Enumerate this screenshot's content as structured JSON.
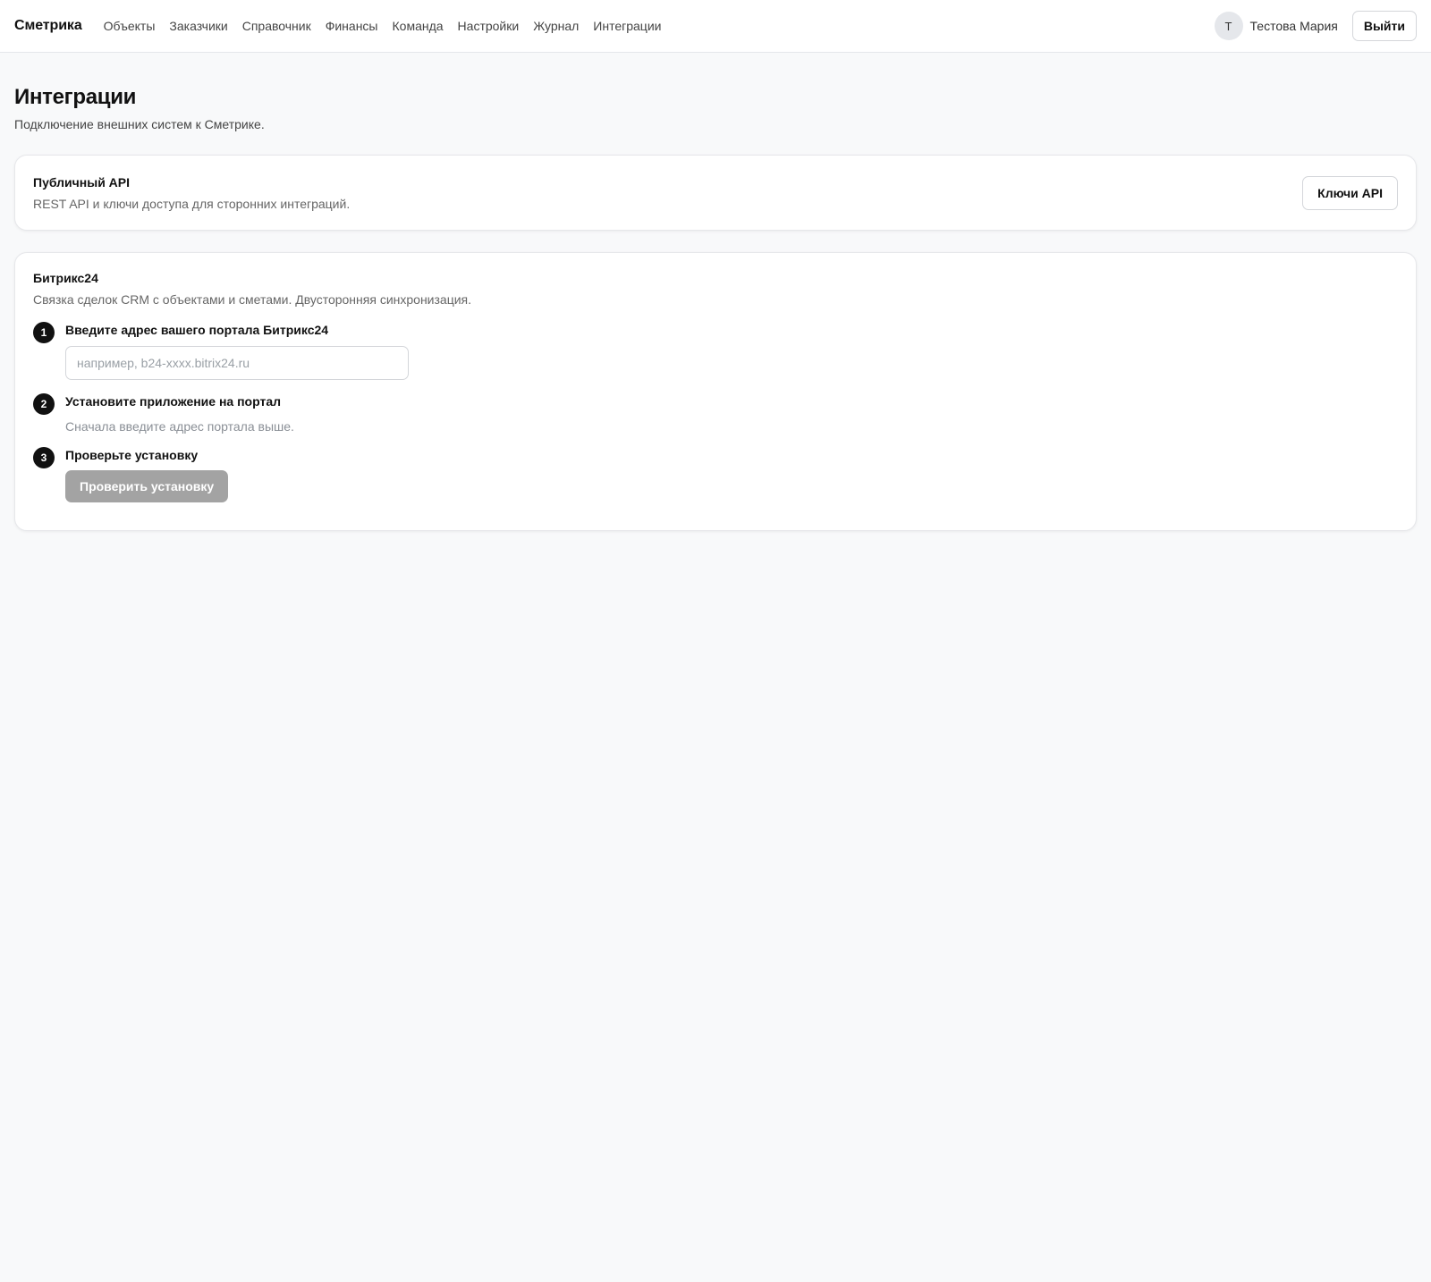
{
  "header": {
    "brand": "Сметрика",
    "nav": [
      "Объекты",
      "Заказчики",
      "Справочник",
      "Финансы",
      "Команда",
      "Настройки",
      "Журнал",
      "Интеграции"
    ],
    "user": {
      "initial": "Т",
      "name": "Тестова Мария"
    },
    "logout_label": "Выйти"
  },
  "page": {
    "title": "Интеграции",
    "subtitle": "Подключение внешних систем к Сметрике."
  },
  "api_card": {
    "title": "Публичный API",
    "description": "REST API и ключи доступа для сторонних интеграций.",
    "button_label": "Ключи API"
  },
  "bitrix_card": {
    "title": "Битрикс24",
    "description": "Связка сделок CRM с объектами и сметами. Двусторонняя синхронизация.",
    "steps": [
      {
        "number": "1",
        "title": "Введите адрес вашего портала Битрикс24",
        "input_placeholder": "например, b24-xxxx.bitrix24.ru",
        "input_value": ""
      },
      {
        "number": "2",
        "title": "Установите приложение на портал",
        "hint": "Сначала введите адрес портала выше."
      },
      {
        "number": "3",
        "title": "Проверьте установку",
        "button_label": "Проверить установку"
      }
    ]
  },
  "colors": {
    "background": "#f8f9fa",
    "card": "#ffffff",
    "step_badge": "#111111",
    "disabled_button": "#a3a3a3"
  }
}
